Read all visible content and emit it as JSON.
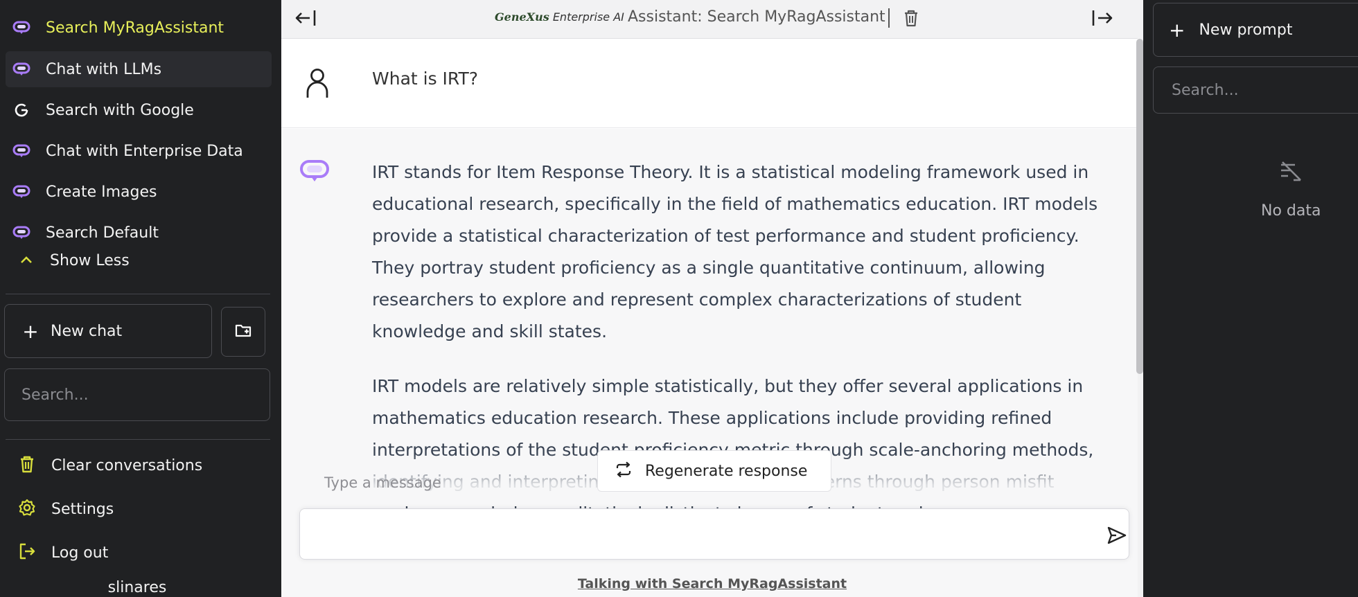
{
  "sidebar": {
    "assistants": [
      {
        "label": "Search MyRagAssistant",
        "icon": "assistant-bubble-icon",
        "active": true
      },
      {
        "label": "Chat with LLMs",
        "icon": "assistant-bubble-icon"
      },
      {
        "label": "Search with Google",
        "icon": "google-icon"
      },
      {
        "label": "Chat with Enterprise Data",
        "icon": "assistant-bubble-icon"
      },
      {
        "label": "Create Images",
        "icon": "assistant-bubble-icon"
      },
      {
        "label": "Search Default",
        "icon": "assistant-bubble-icon"
      }
    ],
    "show_less": "Show Less",
    "new_chat": "New chat",
    "search_placeholder": "Search...",
    "bottom": [
      {
        "label": "Clear conversations",
        "icon": "trash-icon"
      },
      {
        "label": "Settings",
        "icon": "gear-icon"
      },
      {
        "label": "Log out",
        "icon": "logout-icon"
      }
    ],
    "username": "slinares"
  },
  "header": {
    "brand_main": "GeneXus",
    "brand_sub": "Enterprise AI",
    "title": "Assistant: Search MyRagAssistant"
  },
  "conversation": {
    "user_message": "What is IRT?",
    "assistant_paragraphs": [
      "IRT stands for Item Response Theory. It is a statistical modeling framework used in educational research, specifically in the field of mathematics education. IRT models provide a statistical characterization of test performance and student proficiency. They portray student proficiency as a single quantitative continuum, allowing researchers to explore and represent complex characterizations of student knowledge and skill states.",
      "IRT models are relatively simple statistically, but they offer several applications in mathematics education research. These applications include providing refined interpretations of the student proficiency metric through scale-anchoring methods, identifying and interpreting individual response patterns through person misfit analyses, exploring qualitatively distinct classes of students using"
    ]
  },
  "composer": {
    "placeholder": "Type a message",
    "regenerate": "Regenerate response",
    "talking_with": "Talking with Search MyRagAssistant"
  },
  "prompts_panel": {
    "new_prompt": "New prompt",
    "search_placeholder": "Search...",
    "empty": "No data"
  },
  "colors": {
    "sidebar_bg": "#202123",
    "active_label": "#e8f05a",
    "accent_purple": "#a97cf8",
    "icon_yellow": "#d8de3c"
  }
}
